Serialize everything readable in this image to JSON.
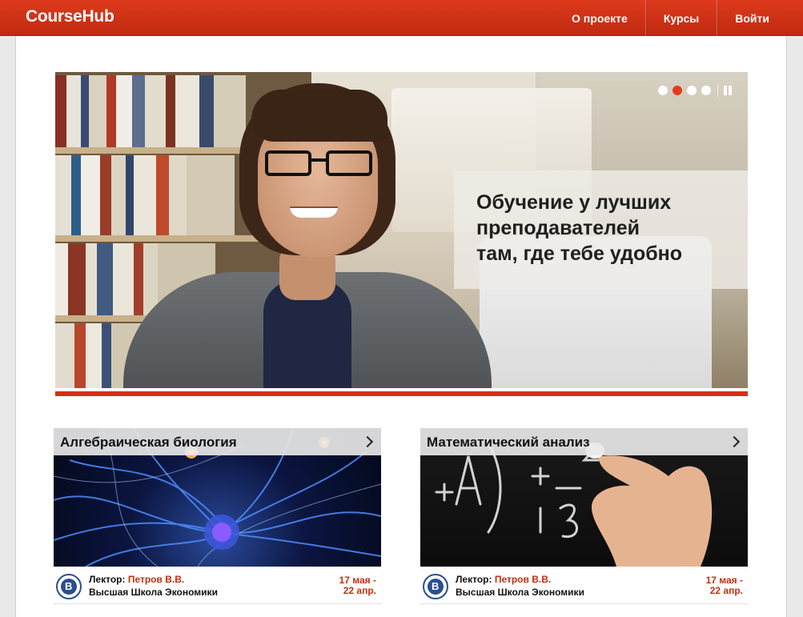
{
  "header": {
    "logo": "CourseHub",
    "nav": [
      "О проекте",
      "Курсы",
      "Войти"
    ]
  },
  "hero": {
    "caption_lines": [
      "Обучение у лучших",
      "преподавателей",
      "там, где тебе удобно"
    ],
    "slides_count": 4,
    "active_slide": 2
  },
  "courses": [
    {
      "title": "Алгебраическая биология",
      "lector_label": "Лектор:",
      "lector_name": "Петров В.В.",
      "school": "Высшая Школа Экономики",
      "date_start": "17 мая -",
      "date_end": "22 апр."
    },
    {
      "title": "Математический анализ",
      "lector_label": "Лектор:",
      "lector_name": "Петров В.В.",
      "school": "Высшая Школа Экономики",
      "date_start": "17 мая -",
      "date_end": "22 апр."
    }
  ],
  "colors": {
    "brand_red": "#d42f15",
    "link_red": "#c0300f"
  }
}
